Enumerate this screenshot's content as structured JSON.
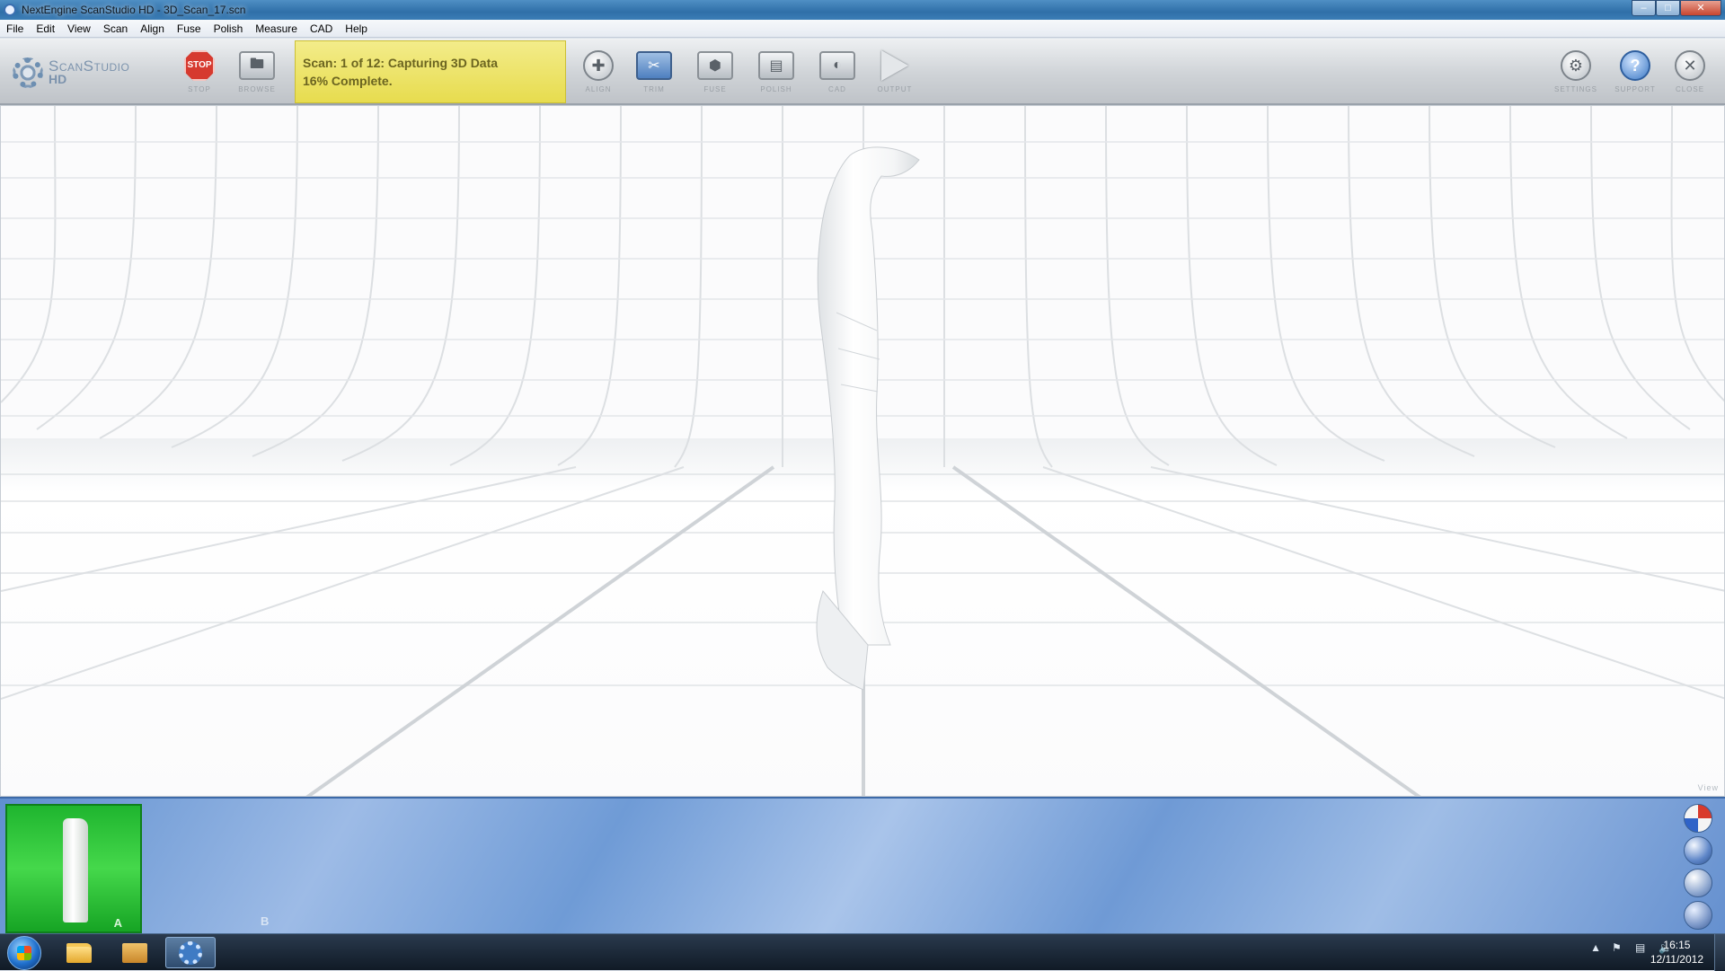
{
  "window": {
    "title": "NextEngine ScanStudio HD - 3D_Scan_17.scn"
  },
  "menu": [
    "File",
    "Edit",
    "View",
    "Scan",
    "Align",
    "Fuse",
    "Polish",
    "Measure",
    "CAD",
    "Help"
  ],
  "logo": {
    "line1": "ScanStudio",
    "line2": "HD"
  },
  "toolbar": {
    "stop": "Stop",
    "browse": "Browse",
    "align": "Align",
    "trim": "Trim",
    "fuse": "Fuse",
    "polish": "Polish",
    "cad": "CAD",
    "output": "Output",
    "settings": "Settings",
    "support": "Support",
    "close": "Close",
    "stop_icon_text": "STOP"
  },
  "status": {
    "line1": "Scan: 1 of 12: Capturing 3D Data",
    "line2": "16% Complete.",
    "progress_percent": 16,
    "color": "#ece169"
  },
  "viewport": {
    "label": "View"
  },
  "strip": {
    "slot_a": "A",
    "slot_b": "B"
  },
  "taskbar": {
    "time": "16:15",
    "date": "12/11/2012"
  },
  "icons": {
    "stop": "stop-sign-icon",
    "browse": "folder-icon",
    "align": "crosshair-icon",
    "trim": "scissors-icon",
    "fuse": "cube-icon",
    "polish": "toolbox-icon",
    "cad": "cad-icon",
    "output": "play-icon",
    "settings": "gear-icon",
    "support": "help-icon",
    "close": "close-icon"
  }
}
